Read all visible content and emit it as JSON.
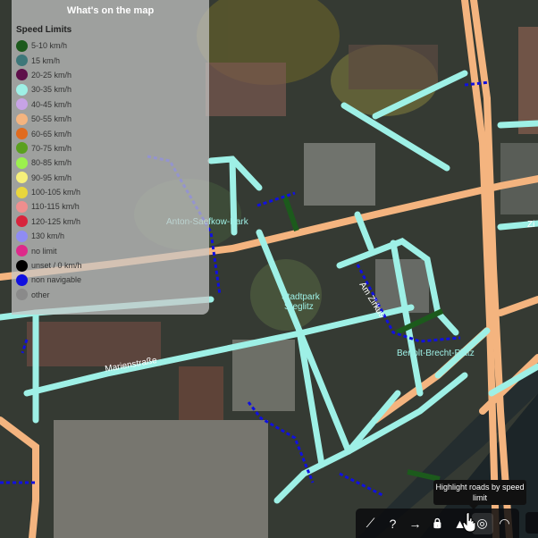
{
  "legend": {
    "title": "What's on the map",
    "subtitle": "Speed Limits",
    "items": [
      {
        "label": "5-10 km/h",
        "color": "#1c5a1c"
      },
      {
        "label": "15 km/h",
        "color": "#3d7779"
      },
      {
        "label": "20-25 km/h",
        "color": "#5e0f4a"
      },
      {
        "label": "30-35 km/h",
        "color": "#9ef0e6"
      },
      {
        "label": "40-45 km/h",
        "color": "#c7a3e5"
      },
      {
        "label": "50-55 km/h",
        "color": "#f4b47f"
      },
      {
        "label": "60-65 km/h",
        "color": "#e06b1e"
      },
      {
        "label": "70-75 km/h",
        "color": "#5aa01e"
      },
      {
        "label": "80-85 km/h",
        "color": "#9cf04e"
      },
      {
        "label": "90-95 km/h",
        "color": "#f6f07a"
      },
      {
        "label": "100-105 km/h",
        "color": "#e9d63c"
      },
      {
        "label": "110-115 km/h",
        "color": "#ef8e8e"
      },
      {
        "label": "120-125 km/h",
        "color": "#d7243c"
      },
      {
        "label": "130 km/h",
        "color": "#8f8cf4"
      },
      {
        "label": "no limit",
        "color": "#dd2a8a"
      },
      {
        "label": "unset / 0 km/h",
        "color": "#000000"
      },
      {
        "label": "non navigable",
        "color": "#1010e0"
      },
      {
        "label": "other",
        "color": "#8a8a8a"
      }
    ]
  },
  "map_labels": {
    "park1": "Anton-Saefkow-Park",
    "park2": "Stadtpark",
    "park2b": "Steglitz",
    "street1": "Marienstraße",
    "street2": "Am Zirkus",
    "square": "Bertolt-Brecht-Platz",
    "edge": "Zi"
  },
  "toolbar": {
    "tooltip": "Highlight roads by speed limit",
    "tools": [
      {
        "name": "draw-line-icon",
        "glyph": "⟋"
      },
      {
        "name": "help-icon",
        "glyph": "?"
      },
      {
        "name": "arrow-right-icon",
        "glyph": "→"
      },
      {
        "name": "lock-icon",
        "glyph": "🔒"
      },
      {
        "name": "road-icon",
        "glyph": "▲"
      },
      {
        "name": "speed-limit-icon",
        "glyph": "◎"
      },
      {
        "name": "speedometer-icon",
        "glyph": "◠"
      }
    ]
  },
  "colors": {
    "speed30": "#9ef0e6",
    "speed50": "#f4b47f",
    "speed5": "#1c5a1c",
    "nonNavigable": "#1010e0"
  }
}
